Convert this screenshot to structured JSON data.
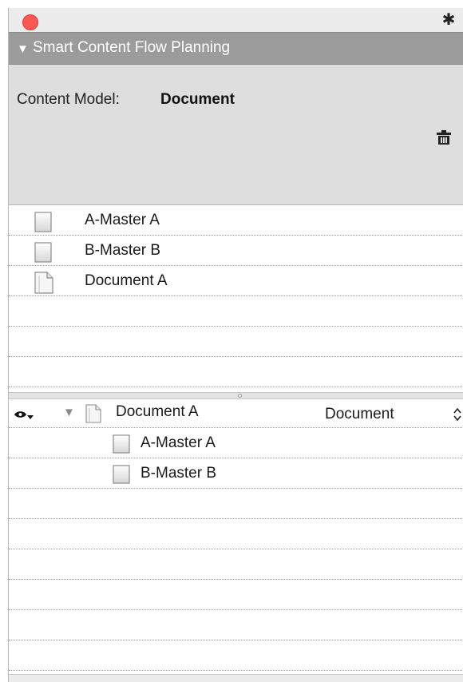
{
  "window": {
    "title": "Smart Content Flow Planning"
  },
  "model": {
    "label": "Content Model:",
    "value": "Document"
  },
  "top_list": {
    "items": [
      {
        "label": "A-Master A",
        "icon": "page-icon"
      },
      {
        "label": "B-Master B",
        "icon": "page-icon"
      },
      {
        "label": "Document A",
        "icon": "document-icon"
      }
    ]
  },
  "bottom_list": {
    "root": {
      "label": "Document A",
      "type": "Document",
      "icon": "document-icon"
    },
    "children": [
      {
        "label": "A-Master A",
        "icon": "page-icon"
      },
      {
        "label": "B-Master B",
        "icon": "page-icon"
      }
    ]
  },
  "colors": {
    "close": "#fc5753",
    "header": "#9b9b9b",
    "model_bg": "#dedede"
  }
}
